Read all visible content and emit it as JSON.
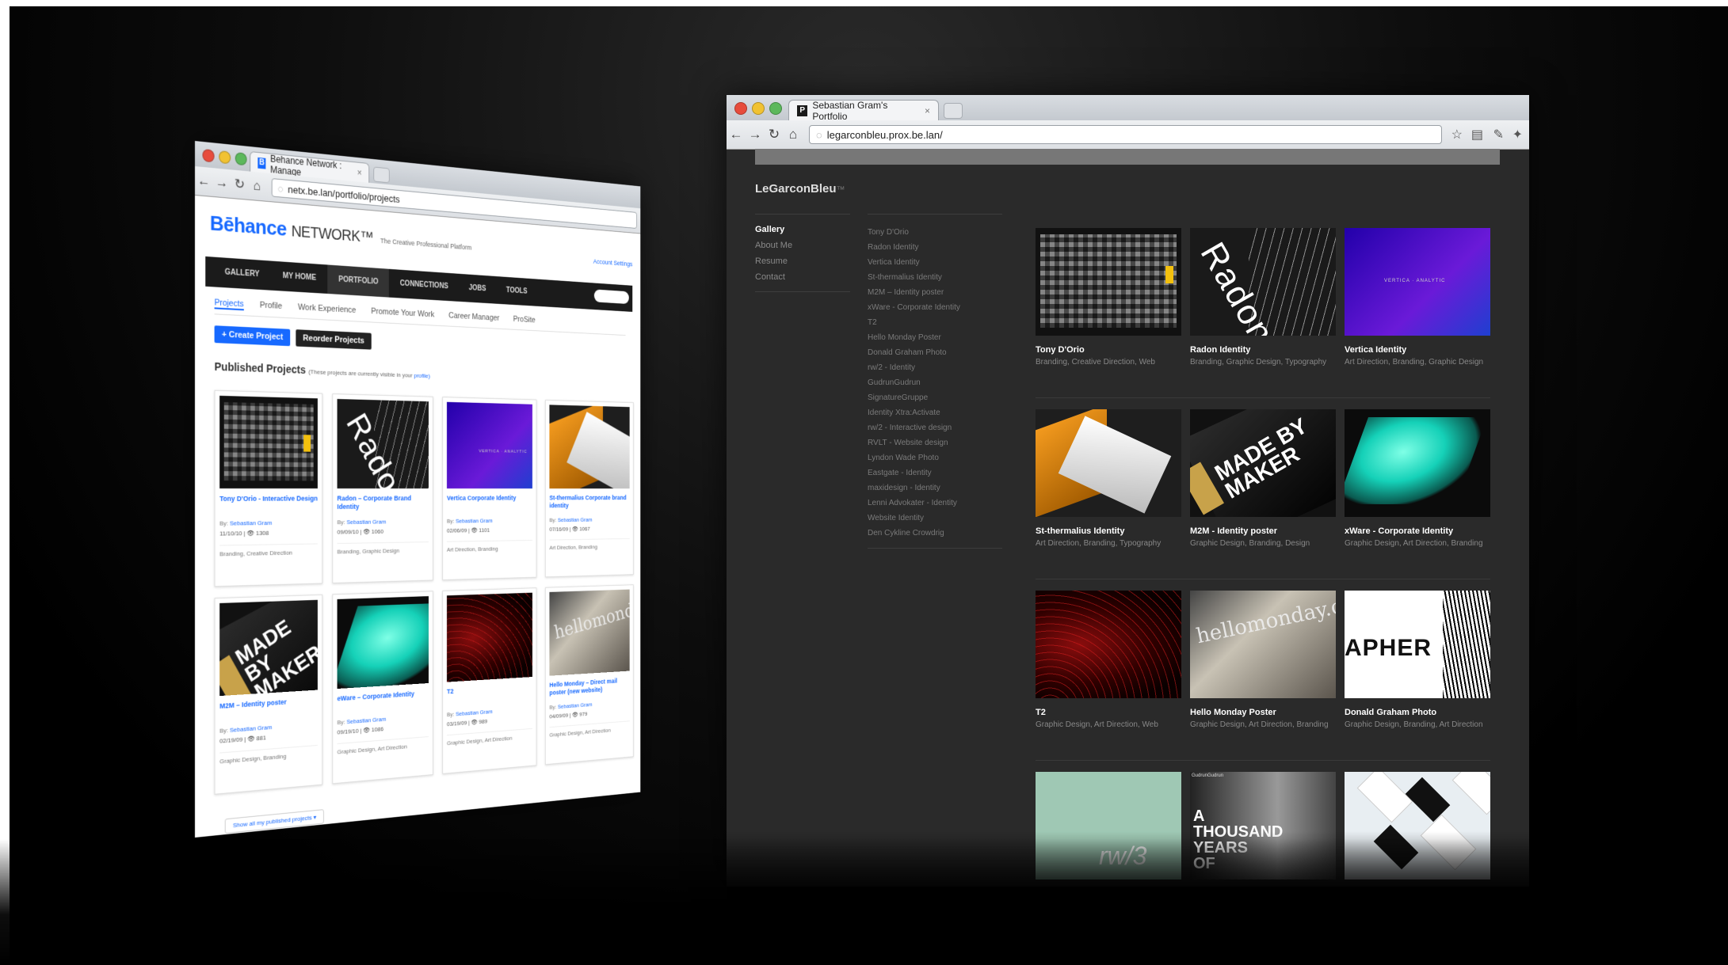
{
  "left_browser": {
    "tab_title": "Behance Network : Manage",
    "url": "netx.be.lan/portfolio/projects",
    "logo_brand": "Bēhance",
    "logo_network": "NETWORK™",
    "tagline": "The Creative Professional Platform",
    "account_settings": "Account Settings",
    "nav": [
      "GALLERY",
      "MY HOME",
      "PORTFOLIO",
      "CONNECTIONS",
      "JOBS",
      "TOOLS"
    ],
    "subtabs": [
      "Projects",
      "Profile",
      "Work Experience",
      "Promote Your Work",
      "Career Manager",
      "ProSite"
    ],
    "create_button": "+ Create Project",
    "reorder_button": "Reorder Projects",
    "published_title": "Published Projects",
    "published_note": "(These projects are currently visible in your",
    "published_note_link": "profile)",
    "cards": [
      {
        "title": "Tony D'Orio - Interactive Design",
        "by": "Sebastian Gram",
        "date": "11/10/10",
        "views": "1308",
        "fields": "Branding, Creative Direction",
        "thumb": "tony"
      },
      {
        "title": "Radon – Corporate Brand Identity",
        "by": "Sebastian Gram",
        "date": "09/09/10",
        "views": "1060",
        "fields": "Branding, Graphic Design",
        "thumb": "radon"
      },
      {
        "title": "Vertica Corporate Identity",
        "by": "Sebastian Gram",
        "date": "02/06/09",
        "views": "1101",
        "fields": "Art Direction, Branding",
        "thumb": "vertica"
      },
      {
        "title": "St-thermalius Corporate brand identity",
        "by": "Sebastian Gram",
        "date": "07/16/09",
        "views": "1067",
        "fields": "Art Direction, Branding",
        "thumb": "st"
      },
      {
        "title": "M2M – Identity poster",
        "by": "Sebastian Gram",
        "date": "02/19/09",
        "views": "881",
        "fields": "Graphic Design, Branding",
        "thumb": "m2m"
      },
      {
        "title": "eWare – Corporate Identity",
        "by": "Sebastian Gram",
        "date": "09/19/10",
        "views": "1086",
        "fields": "Graphic Design, Art Direction",
        "thumb": "xware"
      },
      {
        "title": "T2",
        "by": "Sebastian Gram",
        "date": "03/19/09",
        "views": "989",
        "fields": "Graphic Design, Art Direction",
        "thumb": "t2"
      },
      {
        "title": "Hello Monday – Direct mail poster (new website)",
        "by": "Sebastian Gram",
        "date": "04/09/09",
        "views": "979",
        "fields": "Graphic Design, Art Direction",
        "thumb": "hello"
      }
    ],
    "show_all": "Show all my published projects ▾"
  },
  "right_browser": {
    "tab_title": "Sebastian Gram's Portfolio",
    "url": "legarconbleu.prox.be.lan/",
    "brand": "LeGarconBleu",
    "brand_suffix": "™",
    "menu": [
      "Gallery",
      "About Me",
      "Resume",
      "Contact"
    ],
    "project_list": [
      "Tony D'Orio",
      "Radon Identity",
      "Vertica Identity",
      "St-thermalius Identity",
      "M2M – Identity poster",
      "xWare - Corporate Identity",
      "T2",
      "Hello Monday Poster",
      "Donald Graham Photo",
      "rw/2 - Identity",
      "GudrunGudrun",
      "SignatureGruppe",
      "Identity Xtra:Activate",
      "rw/2 - Interactive design",
      "RVLT - Website design",
      "Lyndon Wade Photo",
      "Eastgate - Identity",
      "maxidesign - Identity",
      "Lenni Advokater - Identity",
      "Website Identity",
      "Den Cykline Crowdrig"
    ],
    "tiles": [
      {
        "name": "Tony D'Orio",
        "tags": "Branding, Creative Direction, Web",
        "thumb": "tony"
      },
      {
        "name": "Radon Identity",
        "tags": "Branding, Graphic Design, Typography",
        "thumb": "radon"
      },
      {
        "name": "Vertica Identity",
        "tags": "Art Direction, Branding, Graphic Design",
        "thumb": "vertica"
      },
      {
        "name": "St-thermalius Identity",
        "tags": "Art Direction, Branding, Typography",
        "thumb": "st"
      },
      {
        "name": "M2M - Identity poster",
        "tags": "Graphic Design, Branding, Design",
        "thumb": "m2m"
      },
      {
        "name": "xWare - Corporate Identity",
        "tags": "Graphic Design, Art Direction, Branding",
        "thumb": "xware"
      },
      {
        "name": "T2",
        "tags": "Graphic Design, Art Direction, Web",
        "thumb": "t2"
      },
      {
        "name": "Hello Monday Poster",
        "tags": "Graphic Design, Art Direction, Branding",
        "thumb": "hello"
      },
      {
        "name": "Donald Graham Photo",
        "tags": "Graphic Design, Branding, Art Direction",
        "thumb": "donald"
      },
      {
        "name": "",
        "tags": "",
        "thumb": "rw"
      },
      {
        "name": "",
        "tags": "",
        "thumb": "thousand"
      },
      {
        "name": "",
        "tags": "",
        "thumb": "cards"
      }
    ],
    "thumb_text": {
      "radon": "Radon",
      "vertica": "VERTICA · ANALYTIC",
      "m2m": "MADE BY MAKER",
      "hello": "hellomonday.com",
      "donald": "APHER",
      "rw": "rw/3",
      "thousand": "A THOUSAND YEARS OF",
      "thousand_header": "GudrunGudrun"
    }
  },
  "icons": {
    "back": "back-arrow-icon",
    "forward": "forward-arrow-icon",
    "reload": "reload-icon",
    "home": "home-icon",
    "star": "star-icon",
    "page": "page-icon",
    "wrench": "wrench-icon"
  }
}
